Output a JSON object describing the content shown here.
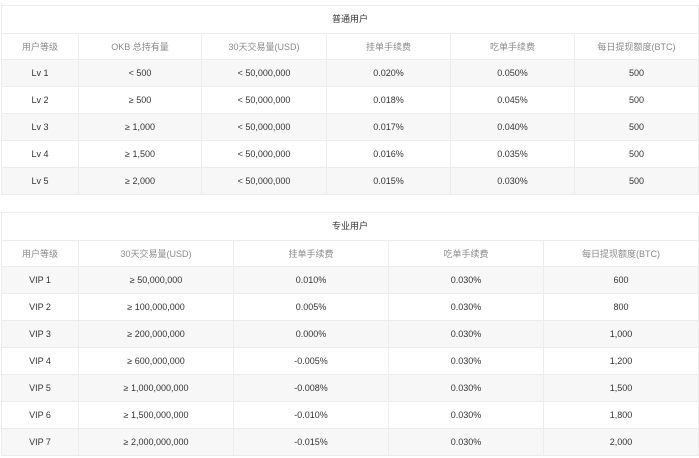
{
  "regular": {
    "title": "普通用户",
    "headers": [
      "用户等级",
      "OKB 总持有量",
      "30天交易量(USD)",
      "挂单手续费",
      "吃单手续费",
      "每日提现额度(BTC)"
    ],
    "rows": [
      [
        "Lv 1",
        "< 500",
        "< 50,000,000",
        "0.020%",
        "0.050%",
        "500"
      ],
      [
        "Lv 2",
        "≥ 500",
        "< 50,000,000",
        "0.018%",
        "0.045%",
        "500"
      ],
      [
        "Lv 3",
        "≥ 1,000",
        "< 50,000,000",
        "0.017%",
        "0.040%",
        "500"
      ],
      [
        "Lv 4",
        "≥ 1,500",
        "< 50,000,000",
        "0.016%",
        "0.035%",
        "500"
      ],
      [
        "Lv 5",
        "≥ 2,000",
        "< 50,000,000",
        "0.015%",
        "0.030%",
        "500"
      ]
    ]
  },
  "pro": {
    "title": "专业用户",
    "headers": [
      "用户等级",
      "30天交易量(USD)",
      "挂单手续费",
      "吃单手续费",
      "每日提现额度(BTC)"
    ],
    "rows": [
      [
        "VIP 1",
        "≥ 50,000,000",
        "0.010%",
        "0.030%",
        "600"
      ],
      [
        "VIP 2",
        "≥ 100,000,000",
        "0.005%",
        "0.030%",
        "800"
      ],
      [
        "VIP 3",
        "≥ 200,000,000",
        "0.000%",
        "0.030%",
        "1,000"
      ],
      [
        "VIP 4",
        "≥ 600,000,000",
        "-0.005%",
        "0.030%",
        "1,200"
      ],
      [
        "VIP 5",
        "≥ 1,000,000,000",
        "-0.008%",
        "0.030%",
        "1,500"
      ],
      [
        "VIP 6",
        "≥ 1,500,000,000",
        "-0.010%",
        "0.030%",
        "1,800"
      ],
      [
        "VIP 7",
        "≥ 2,000,000,000",
        "-0.015%",
        "0.030%",
        "2,000"
      ]
    ]
  }
}
